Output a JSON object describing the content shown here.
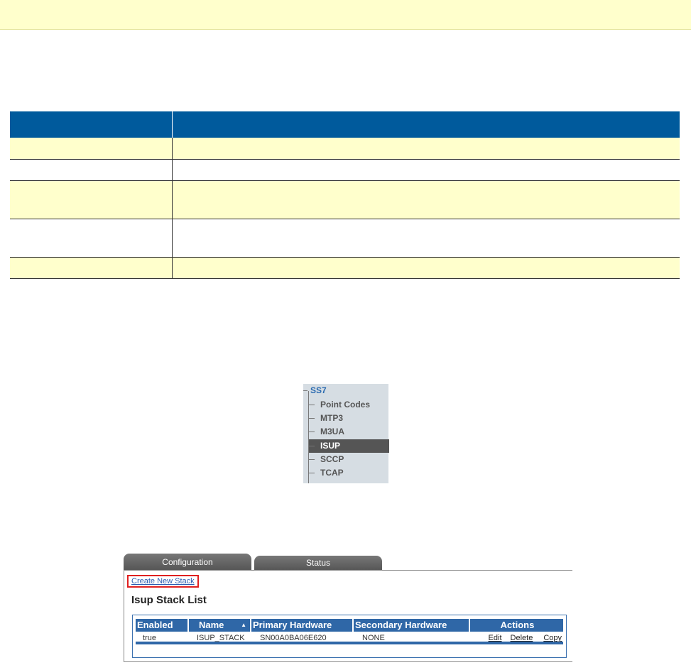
{
  "doc_table": {
    "rows": 5
  },
  "menu": {
    "root": "SS7",
    "items": [
      "Point Codes",
      "MTP3",
      "M3UA",
      "ISUP",
      "SCCP",
      "TCAP"
    ],
    "selected": "ISUP"
  },
  "app": {
    "tabs": [
      "Configuration",
      "Status"
    ],
    "create_link": "Create New Stack",
    "list_title": "Isup Stack List",
    "columns": [
      "Enabled",
      "Name",
      "Primary Hardware",
      "Secondary Hardware",
      "Actions"
    ],
    "sort_indicator": "▲",
    "rows": [
      {
        "enabled": "true",
        "name": "ISUP_STACK",
        "primary": "SN00A0BA06E620",
        "secondary": "NONE",
        "actions": [
          "Edit",
          "Delete",
          "Copy"
        ]
      }
    ]
  }
}
